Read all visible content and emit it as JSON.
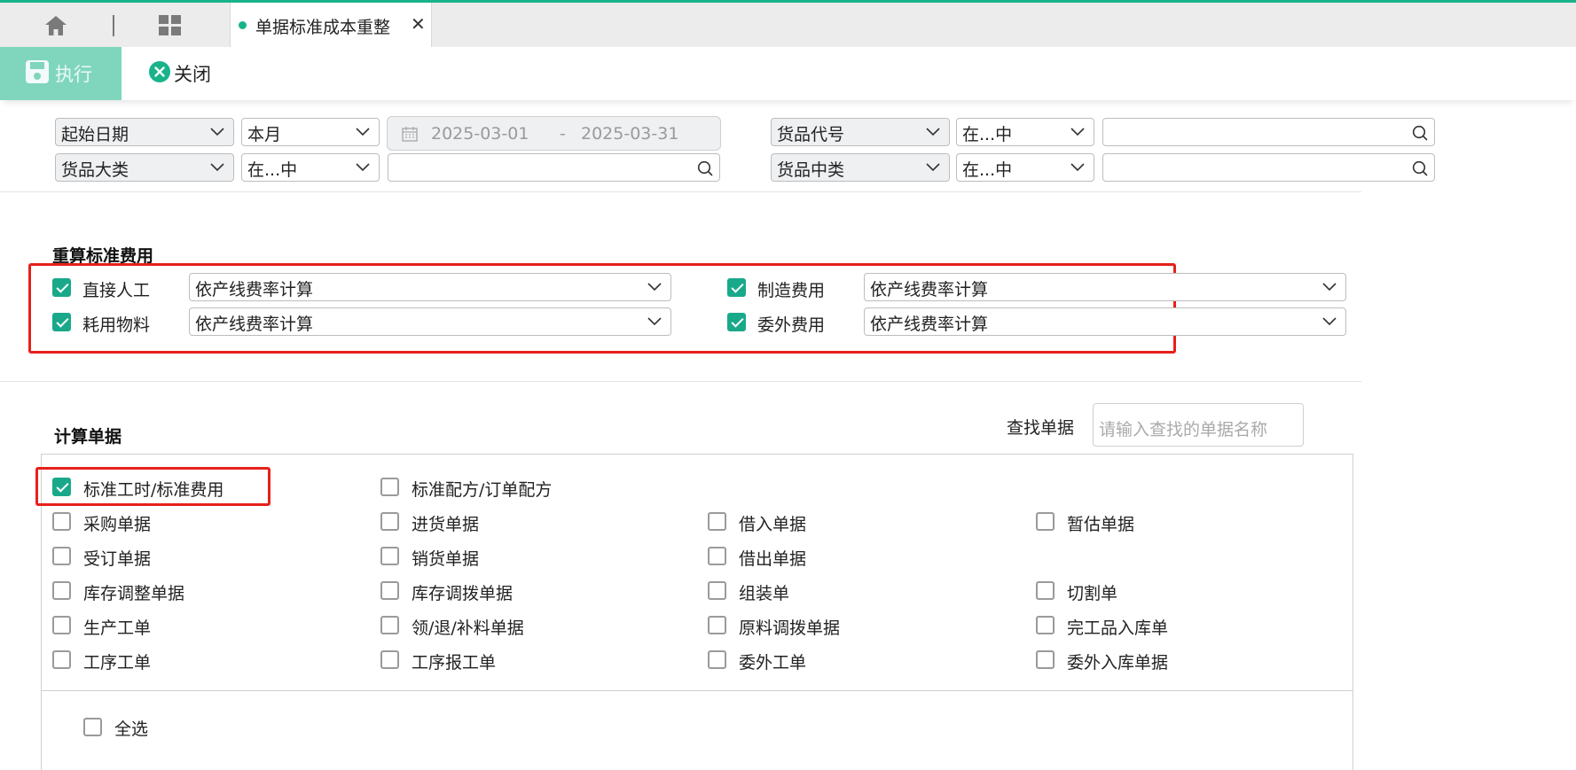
{
  "tabbar": {
    "home_icon": "home-icon",
    "apps_icon": "grid-apps-icon",
    "active_tab": {
      "label": "单据标准成本重整",
      "close_icon": "close-icon"
    },
    "accent_color": "#19b38a"
  },
  "toolbar": {
    "execute_label": "执行",
    "close_label": "关闭",
    "execute_color": "#7fd6bd"
  },
  "filters": {
    "row1": {
      "field1": "起始日期",
      "op1": "本月",
      "date_from": "2025-03-01",
      "date_sep": "-",
      "date_to": "2025-03-31",
      "field2": "货品代号",
      "op2": "在...中",
      "value2": ""
    },
    "row2": {
      "field1": "货品大类",
      "op1": "在...中",
      "value1": "",
      "field2": "货品中类",
      "op2": "在...中",
      "value2": ""
    }
  },
  "recalc": {
    "title": "重算标准费用",
    "items": [
      {
        "label": "直接人工",
        "checked": true,
        "method": "依产线费率计算"
      },
      {
        "label": "制造费用",
        "checked": true,
        "method": "依产线费率计算"
      },
      {
        "label": "耗用物料",
        "checked": true,
        "method": "依产线费率计算"
      },
      {
        "label": "委外费用",
        "checked": true,
        "method": "依产线费率计算"
      }
    ]
  },
  "docs": {
    "title": "计算单据",
    "find_label": "查找单据",
    "find_placeholder": "请输入查找的单据名称",
    "items": [
      {
        "label": "标准工时/标准费用",
        "checked": true
      },
      {
        "label": "标准配方/订单配方",
        "checked": false
      },
      {
        "label": "采购单据",
        "checked": false
      },
      {
        "label": "进货单据",
        "checked": false
      },
      {
        "label": "借入单据",
        "checked": false
      },
      {
        "label": "暂估单据",
        "checked": false
      },
      {
        "label": "受订单据",
        "checked": false
      },
      {
        "label": "销货单据",
        "checked": false
      },
      {
        "label": "借出单据",
        "checked": false
      },
      {
        "label": "库存调整单据",
        "checked": false
      },
      {
        "label": "库存调拨单据",
        "checked": false
      },
      {
        "label": "组装单",
        "checked": false
      },
      {
        "label": "切割单",
        "checked": false
      },
      {
        "label": "生产工单",
        "checked": false
      },
      {
        "label": "领/退/补料单据",
        "checked": false
      },
      {
        "label": "原料调拨单据",
        "checked": false
      },
      {
        "label": "完工品入库单",
        "checked": false
      },
      {
        "label": "工序工单",
        "checked": false
      },
      {
        "label": "工序报工单",
        "checked": false
      },
      {
        "label": "委外工单",
        "checked": false
      },
      {
        "label": "委外入库单据",
        "checked": false
      }
    ],
    "select_all_label": "全选",
    "select_all_checked": false
  },
  "highlight_color": "#e8201b"
}
